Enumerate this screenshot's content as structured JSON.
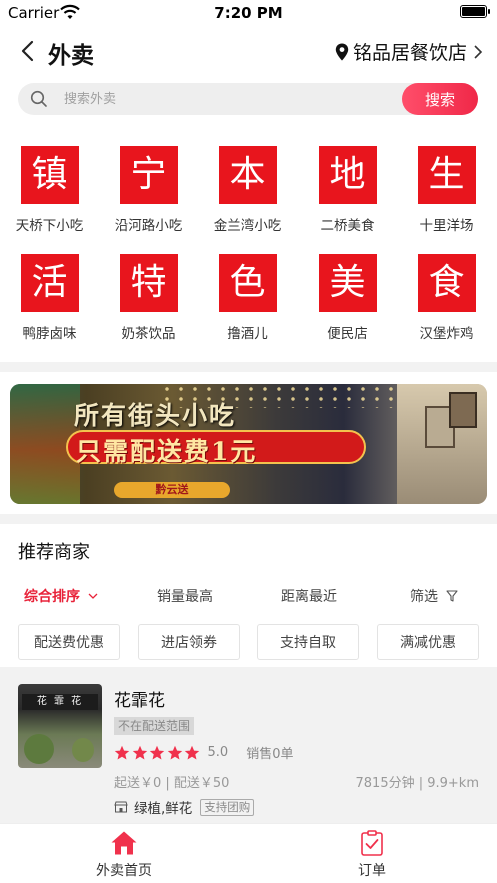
{
  "status_bar": {
    "carrier": "Carrier",
    "time": "7:20 PM"
  },
  "nav": {
    "title": "外卖",
    "location": "铭品居餐饮店"
  },
  "search": {
    "placeholder": "搜索外卖",
    "button": "搜索"
  },
  "categories": [
    {
      "char": "镇",
      "label": "天桥下小吃"
    },
    {
      "char": "宁",
      "label": "沿河路小吃"
    },
    {
      "char": "本",
      "label": "金兰湾小吃"
    },
    {
      "char": "地",
      "label": "二桥美食"
    },
    {
      "char": "生",
      "label": "十里洋场"
    },
    {
      "char": "活",
      "label": "鸭脖卤味"
    },
    {
      "char": "特",
      "label": "奶茶饮品"
    },
    {
      "char": "色",
      "label": "撸酒儿"
    },
    {
      "char": "美",
      "label": "便民店"
    },
    {
      "char": "食",
      "label": "汉堡炸鸡"
    }
  ],
  "banner": {
    "line1": "所有街头小吃",
    "line2": "只需配送费1元",
    "tag": "黔云送"
  },
  "section": {
    "title": "推荐商家"
  },
  "sort": [
    {
      "label": "综合排序",
      "active": true
    },
    {
      "label": "销量最高"
    },
    {
      "label": "距离最近"
    },
    {
      "label": "筛选"
    }
  ],
  "filters": [
    "配送费优惠",
    "进店领券",
    "支持自取",
    "满减优惠"
  ],
  "merchant": {
    "sign_text": "花 霏 花",
    "name": "花霏花",
    "status": "不在配送范围",
    "rating": "5.0",
    "stars": 5,
    "sales": "销售0单",
    "fees": "起送￥0 | 配送￥50",
    "distance": "7815分钟 | 9.9+km",
    "category": "绿植,鲜花",
    "group_tag": "支持团购"
  },
  "tabs": [
    {
      "label": "外卖首页",
      "active": true
    },
    {
      "label": "订单"
    }
  ],
  "colors": {
    "accent": "#e8233a",
    "tile": "#e8151d",
    "search_button": "#f02848"
  }
}
